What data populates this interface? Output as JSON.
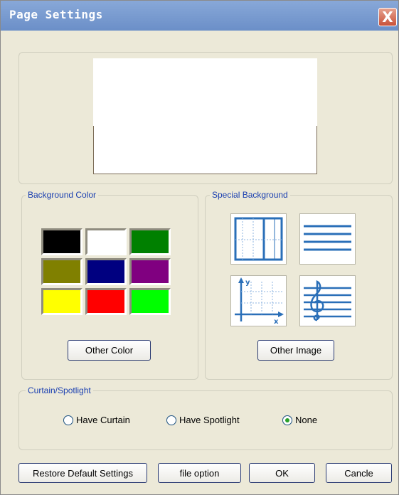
{
  "window": {
    "title": "Page Settings",
    "close_glyph": "X"
  },
  "preview": {},
  "background_color": {
    "label": "Background Color",
    "swatches": [
      "#000000",
      "#ffffff",
      "#008000",
      "#808000",
      "#000080",
      "#800080",
      "#ffff00",
      "#ff0000",
      "#00ff00"
    ],
    "other_button": "Other Color"
  },
  "special_background": {
    "label": "Special Background",
    "tiles": [
      "grid-icon",
      "lines-icon",
      "axes-icon",
      "music-staff-icon"
    ],
    "axis_x": "x",
    "axis_y": "y",
    "other_button": "Other Image"
  },
  "curtain": {
    "label": "Curtain/Spotlight",
    "options": [
      {
        "label": "Have Curtain",
        "selected": false
      },
      {
        "label": "Have Spotlight",
        "selected": false
      },
      {
        "label": "None",
        "selected": true
      }
    ]
  },
  "footer": {
    "restore": "Restore Default Settings",
    "file_option": "file option",
    "ok": "OK",
    "cancel": "Cancle"
  }
}
